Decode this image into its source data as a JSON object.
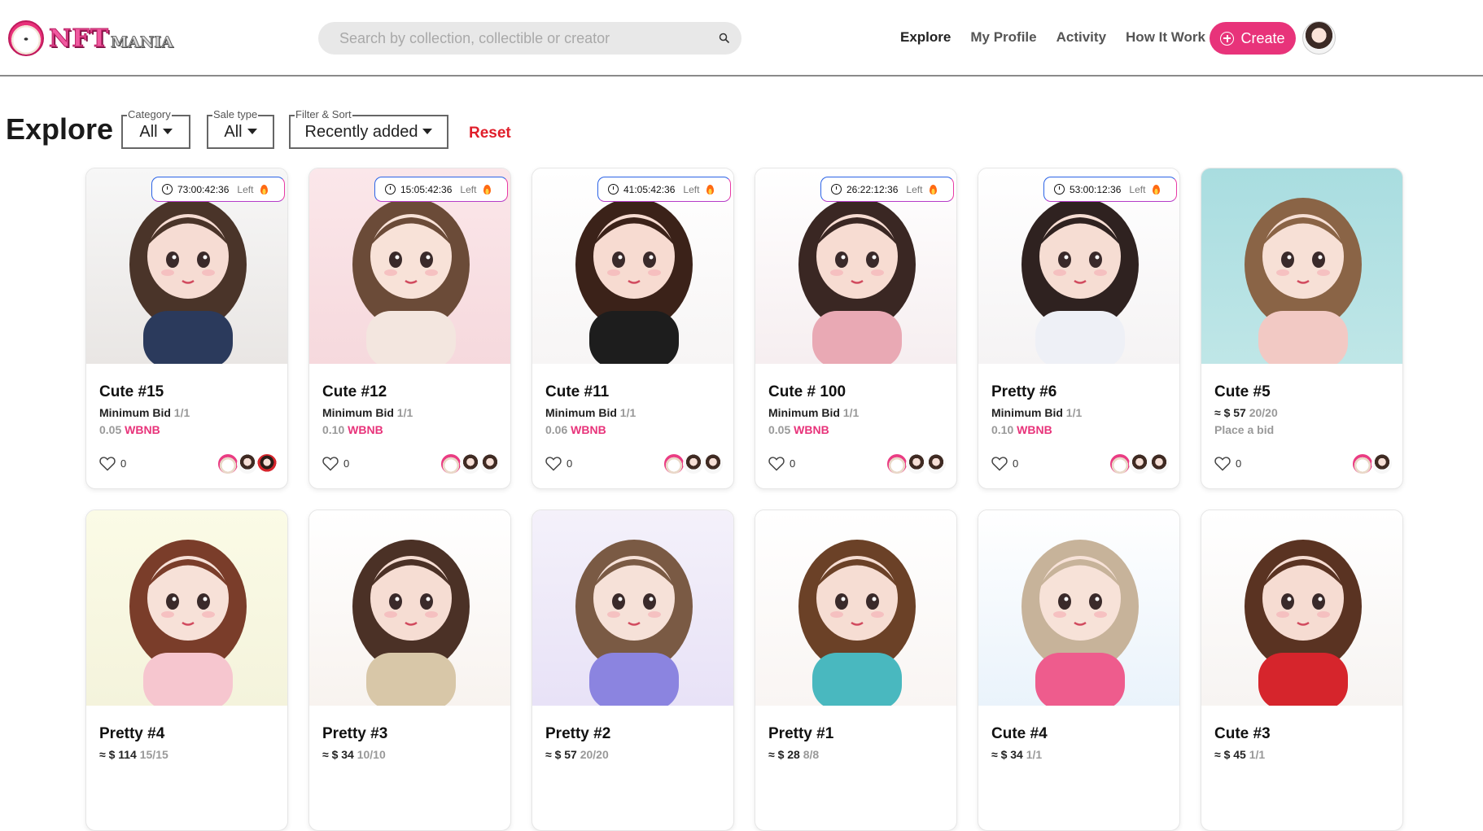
{
  "header": {
    "logo_main": "NFT",
    "logo_sub": "MANIA",
    "search_placeholder": "Search by collection, collectible or creator",
    "nav": [
      "Explore",
      "My Profile",
      "Activity",
      "How It Work"
    ],
    "create_label": "Create"
  },
  "toolbar": {
    "title": "Explore",
    "filters": [
      {
        "label": "Category",
        "value": "All"
      },
      {
        "label": "Sale type",
        "value": "All"
      },
      {
        "label": "Filter & Sort",
        "value": "Recently added"
      }
    ],
    "reset_label": "Reset"
  },
  "cards": [
    {
      "title": "Cute #15",
      "timer": "73:00:42:36",
      "left": "Left",
      "line1_label": "Minimum Bid",
      "line1_muted": "1/1",
      "price": "0.05",
      "currency": "WBNB",
      "likes": "0",
      "avatars": [
        "bear",
        "girl",
        "red"
      ],
      "img": [
        "#f7f7f7",
        "#e9e6e4",
        "#4a3429",
        "#f6dcd3",
        "#2b3a5c"
      ]
    },
    {
      "title": "Cute #12",
      "timer": "15:05:42:36",
      "left": "Left",
      "line1_label": "Minimum Bid",
      "line1_muted": "1/1",
      "price": "0.10",
      "currency": "WBNB",
      "likes": "0",
      "avatars": [
        "bear",
        "girl",
        "girl"
      ],
      "img": [
        "#fbe7ea",
        "#f6d9dd",
        "#6b4b38",
        "#f8e2d8",
        "#f3e6df"
      ]
    },
    {
      "title": "Cute #11",
      "timer": "41:05:42:36",
      "left": "Left",
      "line1_label": "Minimum Bid",
      "line1_muted": "1/1",
      "price": "0.06",
      "currency": "WBNB",
      "likes": "0",
      "avatars": [
        "bear",
        "girl",
        "girl"
      ],
      "img": [
        "#ffffff",
        "#f7f5f5",
        "#3b2219",
        "#f7dbd1",
        "#1d1d1d"
      ]
    },
    {
      "title": "Cute # 100",
      "timer": "26:22:12:36",
      "left": "Left",
      "line1_label": "Minimum Bid",
      "line1_muted": "1/1",
      "price": "0.05",
      "currency": "WBNB",
      "likes": "0",
      "avatars": [
        "bear",
        "girl",
        "girl"
      ],
      "img": [
        "#ffffff",
        "#f6eef0",
        "#3a2723",
        "#f7dcd2",
        "#e9a9b4"
      ]
    },
    {
      "title": "Pretty #6",
      "timer": "53:00:12:36",
      "left": "Left",
      "line1_label": "Minimum Bid",
      "line1_muted": "1/1",
      "price": "0.10",
      "currency": "WBNB",
      "likes": "0",
      "avatars": [
        "bear",
        "girl",
        "girl"
      ],
      "img": [
        "#ffffff",
        "#f5f3f4",
        "#2f2220",
        "#f6ddd3",
        "#eef0f6"
      ]
    },
    {
      "title": "Cute #5",
      "line1_prefix": "≈ $",
      "line1_label": "57",
      "line1_muted": "20/20",
      "line2_text": "Place a bid",
      "likes": "0",
      "avatars": [
        "bear",
        "girl"
      ],
      "img": [
        "#a9dde0",
        "#bfe6e7",
        "#8a6446",
        "#f7e0d6",
        "#f2c9c4"
      ]
    },
    {
      "title": "Pretty #4",
      "line1_prefix": "≈ $",
      "line1_label": "114",
      "line1_muted": "15/15",
      "img": [
        "#fbfbe6",
        "#f4f3dc",
        "#7a3d2a",
        "#f7e1d8",
        "#f6c6cf"
      ]
    },
    {
      "title": "Pretty #3",
      "line1_prefix": "≈ $",
      "line1_label": "34",
      "line1_muted": "10/10",
      "img": [
        "#ffffff",
        "#f8f3ef",
        "#4b3126",
        "#f6ddd3",
        "#d8c7a8"
      ]
    },
    {
      "title": "Pretty #2",
      "line1_prefix": "≈ $",
      "line1_label": "57",
      "line1_muted": "20/20",
      "img": [
        "#f4f1fa",
        "#e8e2f7",
        "#7a5a44",
        "#f6e1d8",
        "#8b84e0"
      ]
    },
    {
      "title": "Pretty #1",
      "line1_prefix": "≈ $",
      "line1_label": "28",
      "line1_muted": "8/8",
      "img": [
        "#ffffff",
        "#f9f5f3",
        "#6b4127",
        "#f6ddd3",
        "#49b8bf"
      ]
    },
    {
      "title": "Cute #4",
      "line1_prefix": "≈ $",
      "line1_label": "34",
      "line1_muted": "1/1",
      "img": [
        "#ffffff",
        "#eaf3fb",
        "#c7b39a",
        "#f7e2d8",
        "#ee5c8d"
      ]
    },
    {
      "title": "Cute #3",
      "line1_prefix": "≈ $",
      "line1_label": "45",
      "line1_muted": "1/1",
      "img": [
        "#ffffff",
        "#f7f4f2",
        "#5a3322",
        "#f6dcd2",
        "#d6252c"
      ]
    }
  ]
}
